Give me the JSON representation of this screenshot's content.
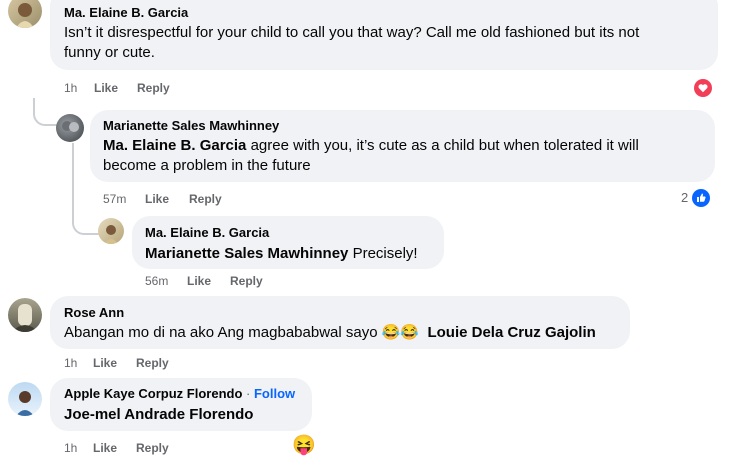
{
  "comments": [
    {
      "author": "Ma. Elaine B. Garcia",
      "text_line1": "Isn’t it disrespectful for your child to call you that way? Call me old fashioned but its not",
      "text_line2": "funny or cute.",
      "time": "1h",
      "like": "Like",
      "reply": "Reply",
      "reaction": "love-icon"
    },
    {
      "author": "Marianette Sales Mawhinney",
      "tag": "Ma. Elaine B. Garcia",
      "text_line1": " agree with you, it’s cute as a child but when tolerated it will",
      "text_line2": "become a problem in the future",
      "time": "57m",
      "like": "Like",
      "reply": "Reply",
      "reaction_count": "2",
      "reaction": "like-icon"
    },
    {
      "author": "Ma. Elaine B. Garcia",
      "tag": "Marianette Sales Mawhinney",
      "text": " Precisely!",
      "time": "56m",
      "like": "Like",
      "reply": "Reply"
    },
    {
      "author": "Rose Ann",
      "text": "Abangan mo di na ako Ang magbababwal sayo ",
      "emojis": [
        "😂",
        "😂"
      ],
      "tag": "Louie Dela Cruz Gajolin",
      "time": "1h",
      "like": "Like",
      "reply": "Reply"
    },
    {
      "author": "Apple Kaye Corpuz Florendo",
      "separator": " · ",
      "follow": "Follow",
      "tag": "Joe-mel Andrade Florendo",
      "time": "1h",
      "like": "Like",
      "reply": "Reply",
      "sticker": "😝"
    }
  ],
  "colors": {
    "bubble": "#f0f2f5",
    "meta_text": "#65676b",
    "link_blue": "#0866ff",
    "love_red": "#f33e58",
    "thread_line": "#ccd0d5"
  }
}
